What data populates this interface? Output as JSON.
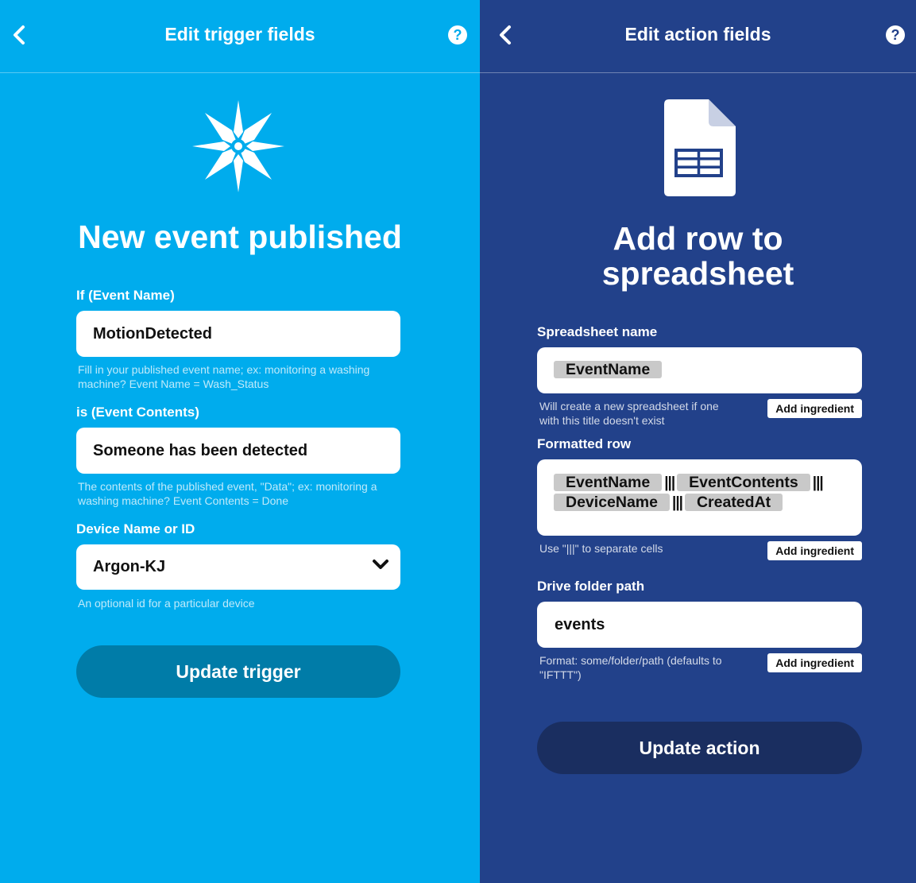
{
  "trigger": {
    "header_title": "Edit trigger fields",
    "help_label": "?",
    "service_icon": "particle-star-icon",
    "hero_title": "New event published",
    "fields": [
      {
        "label": "If (Event Name)",
        "value": "MotionDetected",
        "help": "Fill in your published event name; ex: monitoring a washing machine? Event Name = Wash_Status"
      },
      {
        "label": "is (Event Contents)",
        "value": "Someone has been detected",
        "help": "The contents of the published event, \"Data\"; ex: monitoring a washing machine? Event Contents = Done"
      },
      {
        "label": "Device Name or ID",
        "value": "Argon-KJ",
        "help": "An optional id for a particular device"
      }
    ],
    "button_label": "Update trigger"
  },
  "action": {
    "header_title": "Edit action fields",
    "help_label": "?",
    "service_icon": "google-sheets-icon",
    "hero_title_line1": "Add row to",
    "hero_title_line2": "spreadsheet",
    "spreadsheet_name": {
      "label": "Spreadsheet name",
      "ingredient": "EventName",
      "help": "Will create a new spreadsheet if one with this title doesn't exist",
      "add_label": "Add ingredient"
    },
    "formatted_row": {
      "label": "Formatted row",
      "ingredients": [
        "EventName",
        "EventContents",
        "DeviceName",
        "CreatedAt"
      ],
      "separator": "|||",
      "help": "Use \"|||\" to separate cells",
      "add_label": "Add ingredient"
    },
    "drive_folder": {
      "label": "Drive folder path",
      "value": "events",
      "help": "Format: some/folder/path (defaults to \"IFTTT\")",
      "add_label": "Add ingredient"
    },
    "button_label": "Update action"
  },
  "colors": {
    "trigger_bg": "#00aced",
    "action_bg": "#22418a",
    "trigger_button": "#007ca8",
    "action_button": "#1a2e60",
    "ingredient_pill": "#c9c9c9"
  }
}
